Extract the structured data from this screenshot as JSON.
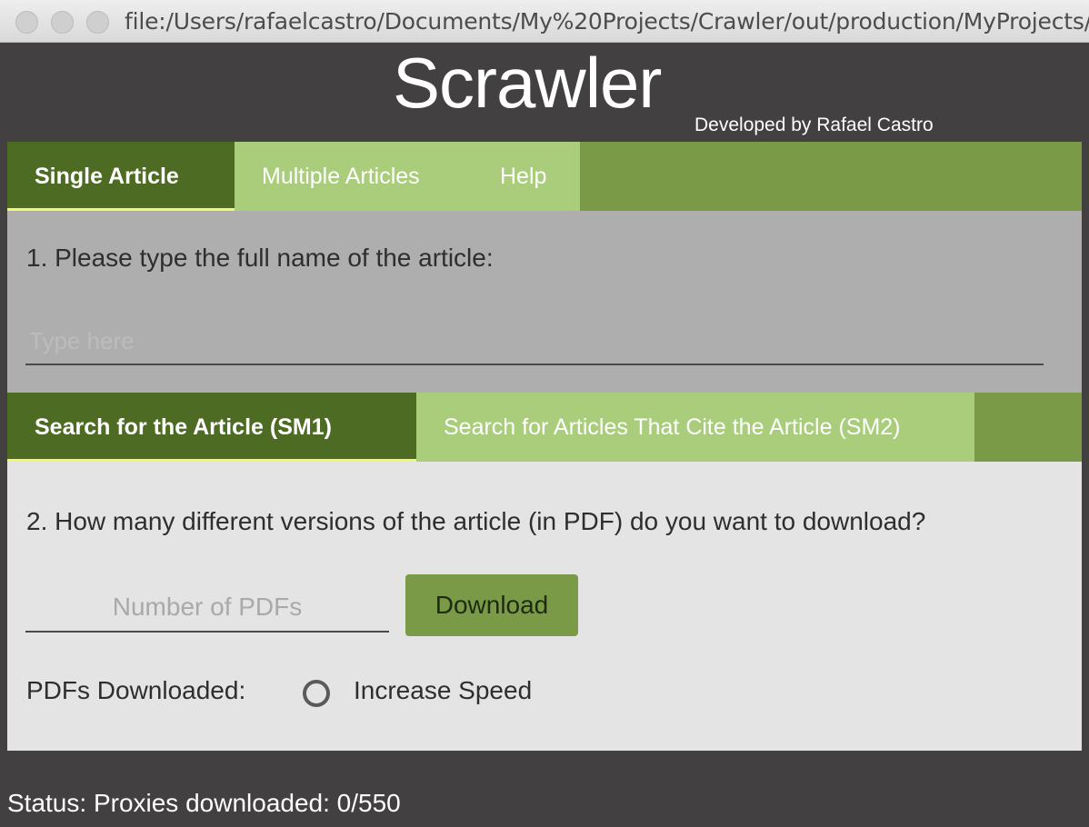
{
  "window": {
    "url": "file:/Users/rafaelcastro/Documents/My%20Projects/Crawler/out/production/MyProjects/"
  },
  "header": {
    "title": "Scrawler",
    "credit": "Developed by Rafael Castro"
  },
  "main_tabs": [
    {
      "label": "Single Article",
      "active": true
    },
    {
      "label": "Multiple Articles",
      "active": false
    },
    {
      "label": "Help",
      "active": false
    }
  ],
  "article_section": {
    "prompt": "1. Please type the full name of the article:",
    "input_placeholder": "Type here",
    "input_value": ""
  },
  "search_tabs": [
    {
      "label": "Search for the Article (SM1)",
      "active": true
    },
    {
      "label": "Search for Articles That Cite the Article (SM2)",
      "active": false
    }
  ],
  "download_section": {
    "prompt": "2. How many different versions of the article (in PDF) do you want to download?",
    "pdf_input_placeholder": "Number of PDFs",
    "pdf_input_value": "",
    "download_label": "Download",
    "pdfs_downloaded_label": "PDFs Downloaded:",
    "increase_speed_label": "Increase Speed",
    "increase_speed_checked": false
  },
  "status": {
    "text": "Status:  Proxies downloaded: 0/550"
  },
  "colors": {
    "background": "#434042",
    "tab_active": "#4e6b24",
    "tab_inactive": "#a9cd7b",
    "tab_bar": "#7a9a48",
    "active_underline": "#f6f27a",
    "button": "#7a9a48"
  },
  "icons": {
    "window_buttons": [
      "close-window-icon",
      "minimize-window-icon",
      "zoom-window-icon"
    ],
    "radio": "radio-unchecked-icon"
  }
}
